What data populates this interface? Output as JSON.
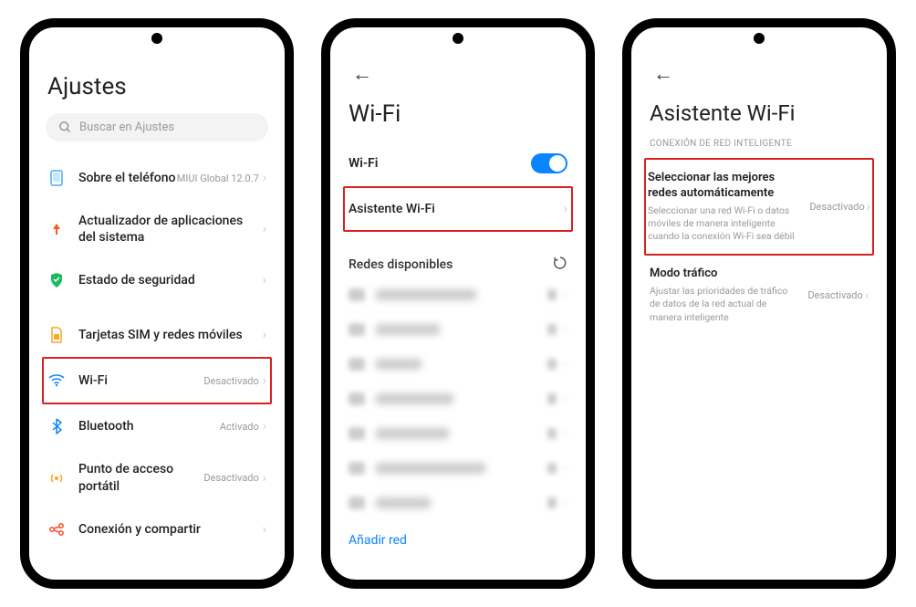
{
  "phone1": {
    "title": "Ajustes",
    "search_placeholder": "Buscar en Ajustes",
    "items": {
      "about": {
        "label": "Sobre el teléfono",
        "value": "MIUI Global 12.0.7"
      },
      "updater": {
        "label": "Actualizador de aplicaciones del sistema"
      },
      "security": {
        "label": "Estado de seguridad"
      },
      "sim": {
        "label": "Tarjetas SIM y redes móviles"
      },
      "wifi": {
        "label": "Wi-Fi",
        "value": "Desactivado"
      },
      "bluetooth": {
        "label": "Bluetooth",
        "value": "Activado"
      },
      "hotspot": {
        "label": "Punto de acceso portátil",
        "value": "Desactivado"
      },
      "share": {
        "label": "Conexión y compartir"
      }
    }
  },
  "phone2": {
    "title": "Wi-Fi",
    "wifi_row": "Wi-Fi",
    "assistant_row": "Asistente Wi-Fi",
    "available_label": "Redes disponibles",
    "add_network": "Añadir red"
  },
  "phone3": {
    "title": "Asistente Wi-Fi",
    "section": "CONEXIÓN DE RED INTELIGENTE",
    "opt1": {
      "title": "Seleccionar las mejores redes automáticamente",
      "desc": "Seleccionar una red Wi-Fi o datos móviles de manera inteligente cuando la conexión Wi-Fi sea débil",
      "value": "Desactivado"
    },
    "opt2": {
      "title": "Modo tráfico",
      "desc": "Ajustar las prioridades de tráfico de datos de la red actual de manera inteligente",
      "value": "Desactivado"
    }
  }
}
